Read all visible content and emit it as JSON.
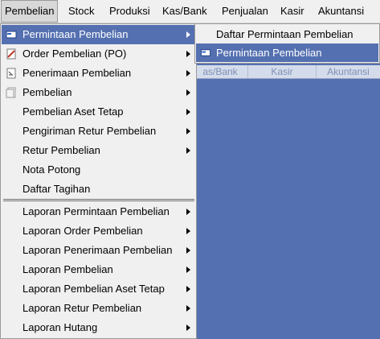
{
  "menubar": {
    "items": [
      {
        "label": "Pembelian"
      },
      {
        "label": "Stock"
      },
      {
        "label": "Produksi"
      },
      {
        "label": "Kas/Bank"
      },
      {
        "label": "Penjualan"
      },
      {
        "label": "Kasir"
      },
      {
        "label": "Akuntansi"
      }
    ]
  },
  "background_toolbar": {
    "items": [
      {
        "label": "as/Bank"
      },
      {
        "label": "Kasir"
      },
      {
        "label": "Akuntansi"
      }
    ]
  },
  "pembelian_menu": {
    "items": [
      {
        "label": "Permintaan Pembelian",
        "icon": "request-form-icon",
        "submenu": true,
        "highlighted": true
      },
      {
        "label": "Order Pembelian (PO)",
        "icon": "purchase-order-icon",
        "submenu": true
      },
      {
        "label": "Penerimaan Pembelian",
        "icon": "receipt-icon",
        "submenu": true
      },
      {
        "label": "Pembelian",
        "icon": "invoice-icon",
        "submenu": true
      },
      {
        "label": "Pembelian Aset Tetap",
        "submenu": true
      },
      {
        "label": "Pengiriman Retur Pembelian",
        "submenu": true
      },
      {
        "label": "Retur Pembelian",
        "submenu": true
      },
      {
        "label": "Nota Potong",
        "submenu": false
      },
      {
        "label": "Daftar Tagihan",
        "submenu": false
      },
      {
        "label": "Laporan Permintaan Pembelian",
        "submenu": true
      },
      {
        "label": "Laporan Order Pembelian",
        "submenu": true
      },
      {
        "label": "Laporan Penerimaan Pembelian",
        "submenu": true
      },
      {
        "label": "Laporan Pembelian",
        "submenu": true
      },
      {
        "label": "Laporan Pembelian Aset Tetap",
        "submenu": true
      },
      {
        "label": "Laporan Retur Pembelian",
        "submenu": true
      },
      {
        "label": "Laporan Hutang",
        "submenu": true
      }
    ]
  },
  "permintaan_submenu": {
    "items": [
      {
        "label": "Daftar Permintaan Pembelian"
      },
      {
        "label": "Permintaan Pembelian",
        "icon": "request-form-icon",
        "highlighted": true
      }
    ]
  },
  "colors": {
    "highlight": "#5470b0",
    "menu_bg": "#f0f0f0",
    "desktop_bg": "#5470b0"
  }
}
